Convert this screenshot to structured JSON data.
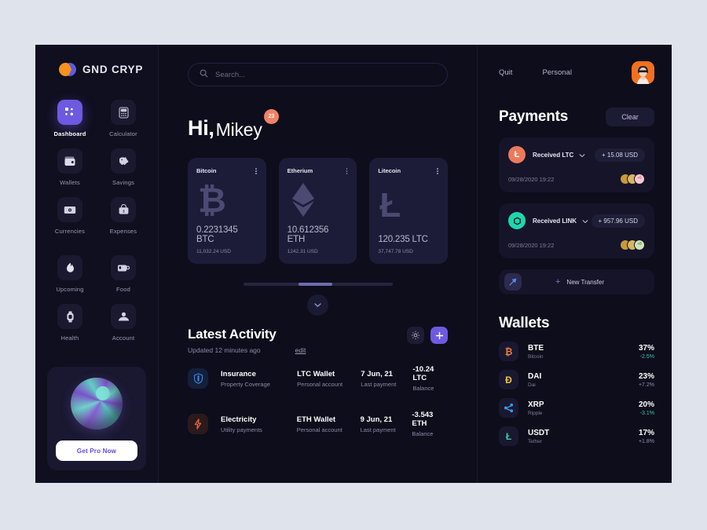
{
  "brand": {
    "name": "GND CRYP",
    "orange": "#f6921e",
    "blue": "#5b5ce2"
  },
  "sidebar": {
    "nav_primary": [
      {
        "label": "Dashboard",
        "icon": "grid-icon",
        "active": true
      },
      {
        "label": "Calculator",
        "icon": "calculator-icon",
        "active": false
      },
      {
        "label": "Wallets",
        "icon": "wallet-icon",
        "active": false
      },
      {
        "label": "Savings",
        "icon": "piggy-bank-icon",
        "active": false
      },
      {
        "label": "Currencies",
        "icon": "banknote-icon",
        "active": false
      },
      {
        "label": "Expenses",
        "icon": "shopping-bag-icon",
        "active": false
      }
    ],
    "nav_secondary": [
      {
        "label": "Upcoming",
        "icon": "flame-icon",
        "active": false
      },
      {
        "label": "Food",
        "icon": "coffee-cup-icon",
        "active": false
      },
      {
        "label": "Health",
        "icon": "smartwatch-icon",
        "active": false
      },
      {
        "label": "Account",
        "icon": "user-icon",
        "active": false
      }
    ],
    "promo": {
      "button_label": "Get Pro Now"
    }
  },
  "search": {
    "placeholder": "Search...",
    "value": ""
  },
  "greeting": {
    "hi": "Hi,",
    "name": "Mikey",
    "badge": "23"
  },
  "coins": [
    {
      "name": "Bitcoin",
      "glyph": "₿",
      "amount": "0.2231345 BTC",
      "usd": "11,032.24 USD"
    },
    {
      "name": "Etherium",
      "glyph": "⧈",
      "amount": "10.612356  ETH",
      "usd": "1242.31 USD"
    },
    {
      "name": "Litecoin",
      "glyph": "Ł",
      "amount": "120.235 LTC",
      "usd": "37,747.78 USD"
    }
  ],
  "activity": {
    "title": "Latest Activity",
    "subtitle": "Updated 12 minutes ago",
    "edit_label": "edit",
    "settings_icon": "gear-icon",
    "add_icon": "plus-icon",
    "rows": [
      {
        "icon": "shield-icon",
        "icon_style": "shield",
        "title": "Insurance",
        "subtitle": "Property Coverage",
        "wallet": "LTC Wallet",
        "wallet_sub": "Personal account",
        "date": "7 Jun, 21",
        "date_sub": "Last payment",
        "balance": "-10.24 LTC",
        "balance_sub": "Balance"
      },
      {
        "icon": "lightning-bolt-icon",
        "icon_style": "bolt",
        "title": "Electricity",
        "subtitle": "Utility payments",
        "wallet": "ETH Wallet",
        "wallet_sub": "Personal account",
        "date": "9 Jun, 21",
        "date_sub": "Last payment",
        "balance": "-3.543 ETH",
        "balance_sub": "Balance"
      }
    ]
  },
  "right": {
    "quit_label": "Quit",
    "personal_label": "Personal",
    "payments_title": "Payments",
    "clear_label": "Clear",
    "payments": [
      {
        "badge_glyph": "Ł",
        "badge_color": "#ec7a5c",
        "label": "Received LTC",
        "amount": "+ 15.08 USD",
        "date": "09/28/2020 19:22",
        "avatars": [
          "#c69a3c",
          "#d9b463",
          "#f6c9d2"
        ],
        "more": "+6"
      },
      {
        "badge_glyph": "⬡",
        "badge_color": "#1fd6ae",
        "label": "Received LINK",
        "amount": "+ 957.96 USD",
        "date": "09/28/2020 19:22",
        "avatars": [
          "#c69a3c",
          "#d9b463",
          "#cfe4b8"
        ],
        "more": "+8"
      }
    ],
    "transfer": {
      "label": "New Transfer",
      "plus": "+",
      "icon": "rocket-icon"
    },
    "wallets_title": "Wallets",
    "wallets": [
      {
        "symbol": "BTE",
        "name": "Bitcoin",
        "glyph": "₿",
        "glyph_color": "#f07c3c",
        "pct": "37%",
        "change": "-2.5%",
        "change_color": "#3bc9a8"
      },
      {
        "symbol": "DAI",
        "name": "Dai",
        "glyph": "Đ",
        "glyph_color": "#e8c545",
        "pct": "23%",
        "change": "+7.2%",
        "change_color": "#8f8eb5"
      },
      {
        "symbol": "XRP",
        "name": "Ripple",
        "glyph": "✵",
        "glyph_color": "#3b9ae8",
        "pct": "20%",
        "change": "-3.1%",
        "change_color": "#3bc9a8"
      },
      {
        "symbol": "USDT",
        "name": "Tether",
        "glyph": "Ł",
        "glyph_color": "#3bc9a8",
        "pct": "17%",
        "change": "+1.8%",
        "change_color": "#8f8eb5"
      }
    ]
  }
}
